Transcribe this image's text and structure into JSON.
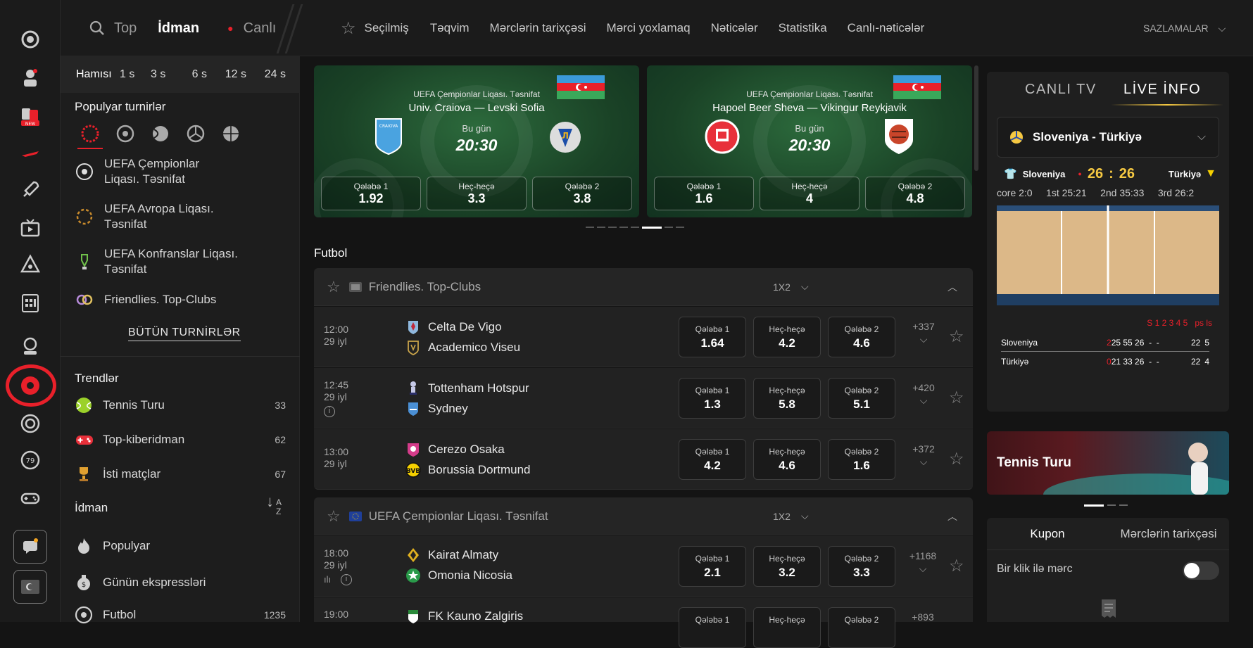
{
  "colors": {
    "accent": "#e8202a",
    "gold": "#f5c842",
    "bg": "#141414",
    "panel": "#1d1d1d",
    "row": "#222222"
  },
  "topbar": {
    "top": "Top",
    "idman": "İdman",
    "canli": "Canlı",
    "secilmis": "Seçilmiş",
    "teqvim": "Təqvim",
    "tarixce": "Mərclərin tarixçəsi",
    "yoxlama": "Mərci yoxlamaq",
    "neticeler": "Nəticələr",
    "statistika": "Statistika",
    "canli_neticeler": "Canlı-nəticələr",
    "settings": "SAZLAMALAR"
  },
  "time_filters": [
    "Hamısı",
    "1 s",
    "3 s",
    "6 s",
    "12 s",
    "24 s"
  ],
  "left": {
    "popular_title": "Populyar turnirlər",
    "tournaments": [
      {
        "name": "UEFA Çempionlar Liqası. Təsnifat",
        "icon": "ucl-icon"
      },
      {
        "name": "UEFA Avropa Liqası. Təsnifat",
        "icon": "uel-icon"
      },
      {
        "name": "UEFA Konfranslar Liqası. Təsnifat",
        "icon": "uecl-icon"
      },
      {
        "name": "Friendlies. Top-Clubs",
        "icon": "friendlies-icon"
      }
    ],
    "all_button": "BÜTÜN TURNİRLƏR",
    "trends_title": "Trendlər",
    "trends": [
      {
        "name": "Tennis Turu",
        "count": "33",
        "icon": "tennis-ball-icon"
      },
      {
        "name": "Top-kiberidman",
        "count": "62",
        "icon": "gamepad-icon"
      },
      {
        "name": "İsti matçlar",
        "count": "67",
        "icon": "trophy-icon"
      }
    ],
    "sports_title": "İdman",
    "sort_label": "A Z",
    "sports": [
      {
        "name": "Populyar",
        "count": "",
        "icon": "fire-icon"
      },
      {
        "name": "Günün ekspressləri",
        "count": "",
        "icon": "money-bag-icon"
      },
      {
        "name": "Futbol",
        "count": "1235",
        "icon": "football-icon"
      }
    ]
  },
  "banners": [
    {
      "league": "UEFA Çempionlar Liqası. Təsnifat",
      "teams": "Univ. Craiova  —  Levski Sofia",
      "day": "Bu gün",
      "time": "20:30",
      "odds": [
        {
          "label": "Qələbə 1",
          "value": "1.92"
        },
        {
          "label": "Heç-heçə",
          "value": "3.3"
        },
        {
          "label": "Qələbə 2",
          "value": "3.8"
        }
      ]
    },
    {
      "league": "UEFA Çempionlar Liqası. Təsnifat",
      "teams": "Hapoel Beer Sheva  —  Vikingur Reykjavik",
      "day": "Bu gün",
      "time": "20:30",
      "odds": [
        {
          "label": "Qələbə 1",
          "value": "1.6"
        },
        {
          "label": "Heç-heçə",
          "value": "4"
        },
        {
          "label": "Qələbə 2",
          "value": "4.8"
        }
      ]
    }
  ],
  "section_title": "Futbol",
  "leagues": [
    {
      "name": "Friendlies. Top-Clubs",
      "market": "1X2",
      "matches": [
        {
          "time": "12:00",
          "date": "29 iyl",
          "home": "Celta De Vigo",
          "away": "Academico Viseu",
          "odds": [
            {
              "label": "Qələbə 1",
              "value": "1.64"
            },
            {
              "label": "Heç-heçə",
              "value": "4.2"
            },
            {
              "label": "Qələbə 2",
              "value": "4.6"
            }
          ],
          "more": "+337"
        },
        {
          "time": "12:45",
          "date": "29 iyl",
          "home": "Tottenham Hotspur",
          "away": "Sydney",
          "odds": [
            {
              "label": "Qələbə 1",
              "value": "1.3"
            },
            {
              "label": "Heç-heçə",
              "value": "5.8"
            },
            {
              "label": "Qələbə 2",
              "value": "5.1"
            }
          ],
          "more": "+420"
        },
        {
          "time": "13:00",
          "date": "29 iyl",
          "home": "Cerezo Osaka",
          "away": "Borussia Dortmund",
          "odds": [
            {
              "label": "Qələbə 1",
              "value": "4.2"
            },
            {
              "label": "Heç-heçə",
              "value": "4.6"
            },
            {
              "label": "Qələbə 2",
              "value": "1.6"
            }
          ],
          "more": "+372"
        }
      ]
    },
    {
      "name": "UEFA Çempionlar Liqası. Təsnifat",
      "market": "1X2",
      "matches": [
        {
          "time": "18:00",
          "date": "29 iyl",
          "home": "Kairat Almaty",
          "away": "Omonia Nicosia",
          "odds": [
            {
              "label": "Qələbə 1",
              "value": "2.1"
            },
            {
              "label": "Heç-heçə",
              "value": "3.2"
            },
            {
              "label": "Qələbə 2",
              "value": "3.3"
            }
          ],
          "more": "+1168"
        },
        {
          "time": "19:00",
          "date": "",
          "home": "FK Kauno Zalgiris",
          "away": "",
          "odds": [
            {
              "label": "Qələbə 1",
              "value": ""
            },
            {
              "label": "Heç-heçə",
              "value": ""
            },
            {
              "label": "Qələbə 2",
              "value": ""
            }
          ],
          "more": "+893"
        }
      ]
    }
  ],
  "right": {
    "tab_tv": "CANLI TV",
    "tab_info": "LİVE İNFO",
    "match_select": "Sloveniya - Türkiyə",
    "home": "Sloveniya",
    "away": "Türkiyə",
    "home_score": "26",
    "sep": ":",
    "away_score": "26",
    "periods": "core 2:0     1st 25:21     2nd 35:33     3rd 26:2",
    "table_header": "S 1 2 3 4 5   ps ls",
    "rows": [
      {
        "team": "Sloveniya",
        "sets": "2",
        "scores": "25 55 26  -  -",
        "ps": "22",
        "ls": "5"
      },
      {
        "team": "Türkiyə",
        "sets": "0",
        "scores": "21 33 26  -  -",
        "ps": "22",
        "ls": "4"
      }
    ],
    "promo": "Tennis Turu",
    "coupon_tab": "Kupon",
    "history_tab": "Mərclərin tarixçəsi",
    "one_click": "Bir klik ilə mərc"
  }
}
